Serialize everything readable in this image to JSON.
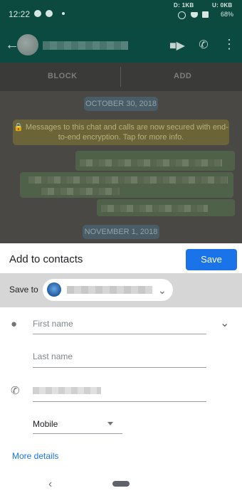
{
  "status_bar": {
    "time": "12:22",
    "download": "D: 1KB",
    "upload": "U: 0KB",
    "battery": "68%"
  },
  "chat": {
    "actions": {
      "block": "BLOCK",
      "add": "ADD"
    },
    "dates": [
      "OCTOBER 30, 2018",
      "NOVEMBER 1, 2018"
    ],
    "encryption_notice": "🔒 Messages to this chat and calls are now secured with end-to-end encryption. Tap for more info."
  },
  "sheet": {
    "title": "Add to contacts",
    "save_label": "Save",
    "save_to_label": "Save to",
    "first_name_placeholder": "First name",
    "last_name_placeholder": "Last name",
    "phone_type": "Mobile",
    "more_details": "More details"
  },
  "icons": {
    "back": "arrow-back-icon",
    "video": "video-call-icon",
    "call": "phone-icon",
    "menu": "more-vert-icon",
    "person": "person-icon",
    "phone_field": "phone-icon",
    "expand": "chevron-down-icon",
    "nav_back": "nav-back-icon",
    "nav_home": "home-pill-icon"
  },
  "colors": {
    "accent": "#1a73e8",
    "app_bar": "#0b4a40",
    "scrim_bg": "#4a4845"
  }
}
